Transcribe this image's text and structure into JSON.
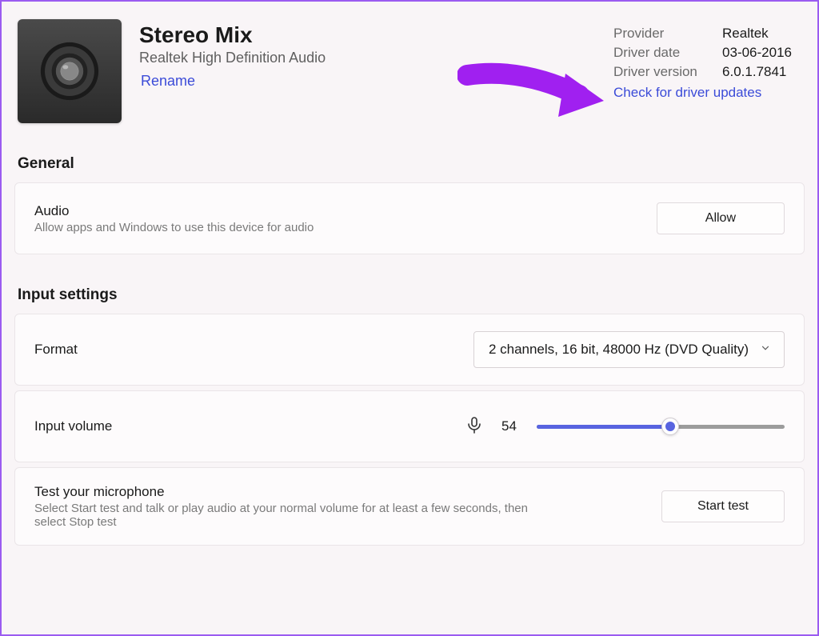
{
  "header": {
    "device_name": "Stereo Mix",
    "device_description": "Realtek High Definition Audio",
    "rename_label": "Rename"
  },
  "driver": {
    "provider_label": "Provider",
    "provider_value": "Realtek",
    "date_label": "Driver date",
    "date_value": "03-06-2016",
    "version_label": "Driver version",
    "version_value": "6.0.1.7841",
    "check_updates_label": "Check for driver updates"
  },
  "sections": {
    "general": "General",
    "input_settings": "Input settings"
  },
  "audio_card": {
    "title": "Audio",
    "subtitle": "Allow apps and Windows to use this device for audio",
    "button_label": "Allow"
  },
  "format_card": {
    "title": "Format",
    "selected_value": "2 channels, 16 bit, 48000 Hz (DVD Quality)"
  },
  "volume_card": {
    "title": "Input volume",
    "value": 54,
    "value_display": "54"
  },
  "mic_test_card": {
    "title": "Test your microphone",
    "subtitle": "Select Start test and talk or play audio at your normal volume for at least a few seconds, then select Stop test",
    "button_label": "Start test"
  },
  "colors": {
    "accent": "#5864e0",
    "link": "#3b4bd8",
    "annotation": "#a020f0"
  }
}
